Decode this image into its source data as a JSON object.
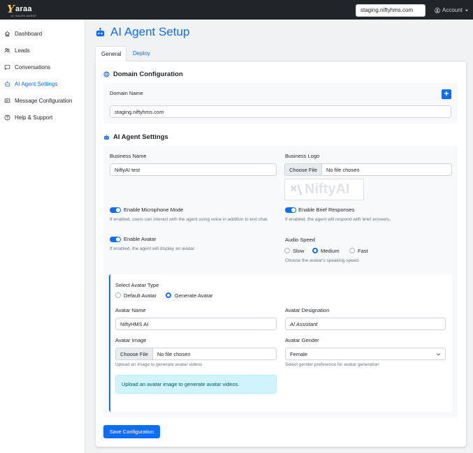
{
  "app": {
    "logo_letter": "Y",
    "logo_word": "araa",
    "logo_tagline": "AI SALES AGENT"
  },
  "header": {
    "domain_value": "staging.niftyhms.com",
    "account_label": "Account"
  },
  "sidebar": {
    "items": [
      {
        "label": "Dashboard",
        "icon": "home-icon"
      },
      {
        "label": "Leads",
        "icon": "users-icon"
      },
      {
        "label": "Conversations",
        "icon": "chat-icon"
      },
      {
        "label": "AI Agent Settings",
        "icon": "robot-icon",
        "active": true
      },
      {
        "label": "Message Configuration",
        "icon": "message-icon"
      },
      {
        "label": "Help & Support",
        "icon": "question-icon"
      }
    ]
  },
  "page": {
    "title": "AI Agent Setup",
    "tabs": [
      "General",
      "Deploy"
    ]
  },
  "domain_config": {
    "title": "Domain Configuration",
    "label": "Domain Name",
    "add_button": "+",
    "value": "staging.niftyhms.com"
  },
  "agent_settings": {
    "title": "AI Agent Settings",
    "business_name_label": "Business Name",
    "business_name_value": "NiftyAI test",
    "business_logo_label": "Business Logo",
    "choose_file": "Choose File",
    "no_file": "No file chosen",
    "mic_label": "Enable Microphone Mode",
    "mic_help": "If enabled, users can interact with the agent using voice in addition to text chat.",
    "brief_label": "Enable Brief Responses",
    "brief_help": "If enabled, the agent will respond with brief answers.",
    "avatar_label": "Enable Avatar",
    "avatar_help": "If enabled, the agent will display an avatar.",
    "audio_speed_label": "Audio Speed",
    "speed_options": [
      "Slow",
      "Medium",
      "Fast"
    ],
    "speed_selected": "Medium",
    "audio_speed_help": "Choose the avatar's speaking speed."
  },
  "avatar": {
    "select_type_label": "Select Avatar Type",
    "type_options": [
      "Default Avatar",
      "Generate Avatar"
    ],
    "type_selected": "Generate Avatar",
    "name_label": "Avatar Name",
    "name_value": "NiftyHMS AI",
    "designation_label": "Avatar Designation",
    "designation_value": "AI Assistant",
    "image_label": "Avatar Image",
    "choose_file": "Choose File",
    "no_file": "No file chosen",
    "image_help": "Upload an image to generate avatar videos",
    "gender_label": "Avatar Gender",
    "gender_value": "Female",
    "gender_help": "Select gender preference for avatar generation",
    "info_text": "Upload an avatar image to generate avatar videos."
  },
  "save_button": "Save Configuration",
  "colors": {
    "accent": "#0d6efd",
    "topbar": "#212529",
    "info_bg": "#cff4fc"
  }
}
